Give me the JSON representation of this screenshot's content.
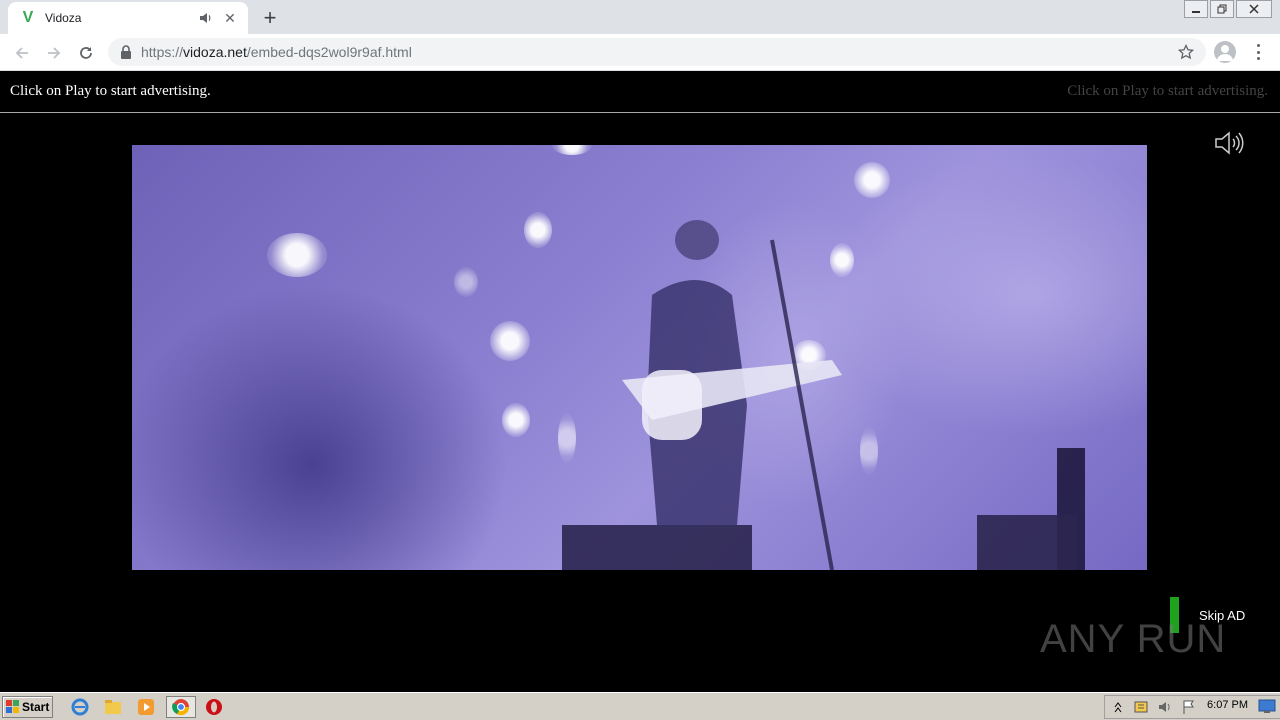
{
  "browser": {
    "tab": {
      "title": "Vidoza",
      "favicon": "V"
    },
    "url": {
      "scheme": "https://",
      "host": "vidoza.net",
      "path": "/embed-dqs2wol9r9af.html"
    }
  },
  "page": {
    "ad_text_left": "Click on Play to start advertising.",
    "ad_text_right": "Click on Play to start advertising.",
    "skip_label": "Skip AD",
    "watermark": "ANY RUN"
  },
  "taskbar": {
    "start_label": "Start",
    "clock": "6:07 PM"
  },
  "colors": {
    "skip_bar": "#1fa31f",
    "tab_favicon": "#3aa757"
  }
}
